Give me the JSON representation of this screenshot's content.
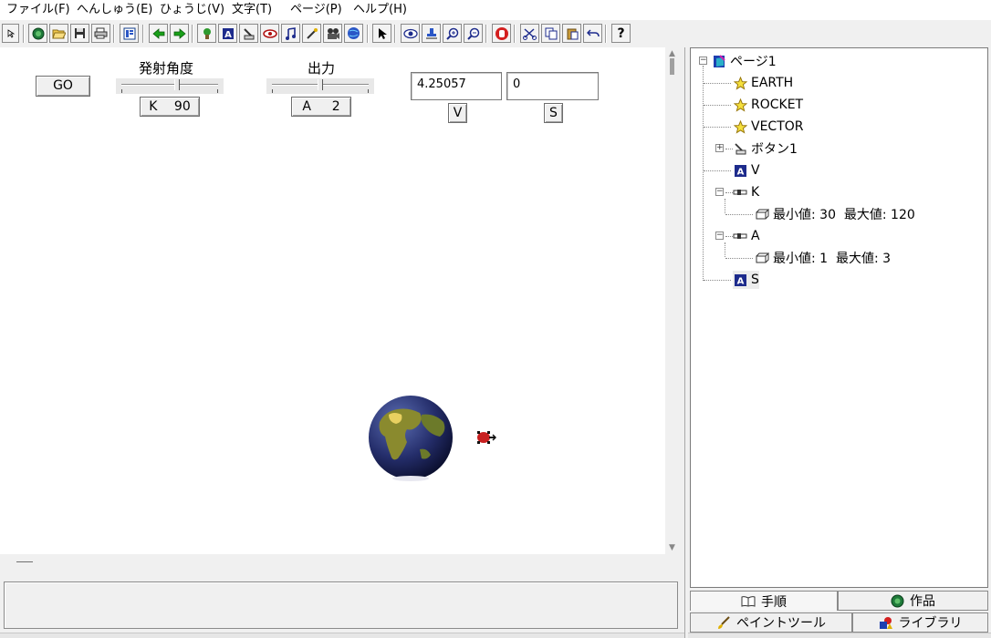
{
  "menu": [
    "ファイル(F)",
    "へんしゅう(E)",
    "ひょうじ(V)",
    "文字(T)",
    "ページ(P)",
    "ヘルプ(H)"
  ],
  "stage": {
    "go_button": "GO",
    "angle_label": "発射角度",
    "angle_slider": {
      "name": "K",
      "value": "90",
      "level": 0.58
    },
    "power_label": "出力",
    "power_slider": {
      "name": "A",
      "value": "2",
      "level": 0.5
    },
    "v_field": "4.25057",
    "v_button": "V",
    "s_field": "0",
    "s_button": "S"
  },
  "tree": {
    "root": "ページ1",
    "items": [
      {
        "label": "EARTH",
        "icon": "star-actor-icon"
      },
      {
        "label": "ROCKET",
        "icon": "star-actor-icon"
      },
      {
        "label": "VECTOR",
        "icon": "star-actor-icon"
      },
      {
        "label": "ボタン1",
        "icon": "button-part-icon"
      },
      {
        "label": "V",
        "icon": "text-box-icon"
      },
      {
        "label": "K",
        "icon": "slider-part-icon",
        "child": "最小値: 30  最大値: 120"
      },
      {
        "label": "A",
        "icon": "slider-part-icon",
        "child": "最小値: 1  最大値: 3"
      },
      {
        "label": "S",
        "icon": "text-box-icon"
      }
    ]
  },
  "tabs": {
    "procedure": "手順",
    "works": "作品",
    "paint_tool": "ペイントツール",
    "library": "ライブラリ"
  }
}
